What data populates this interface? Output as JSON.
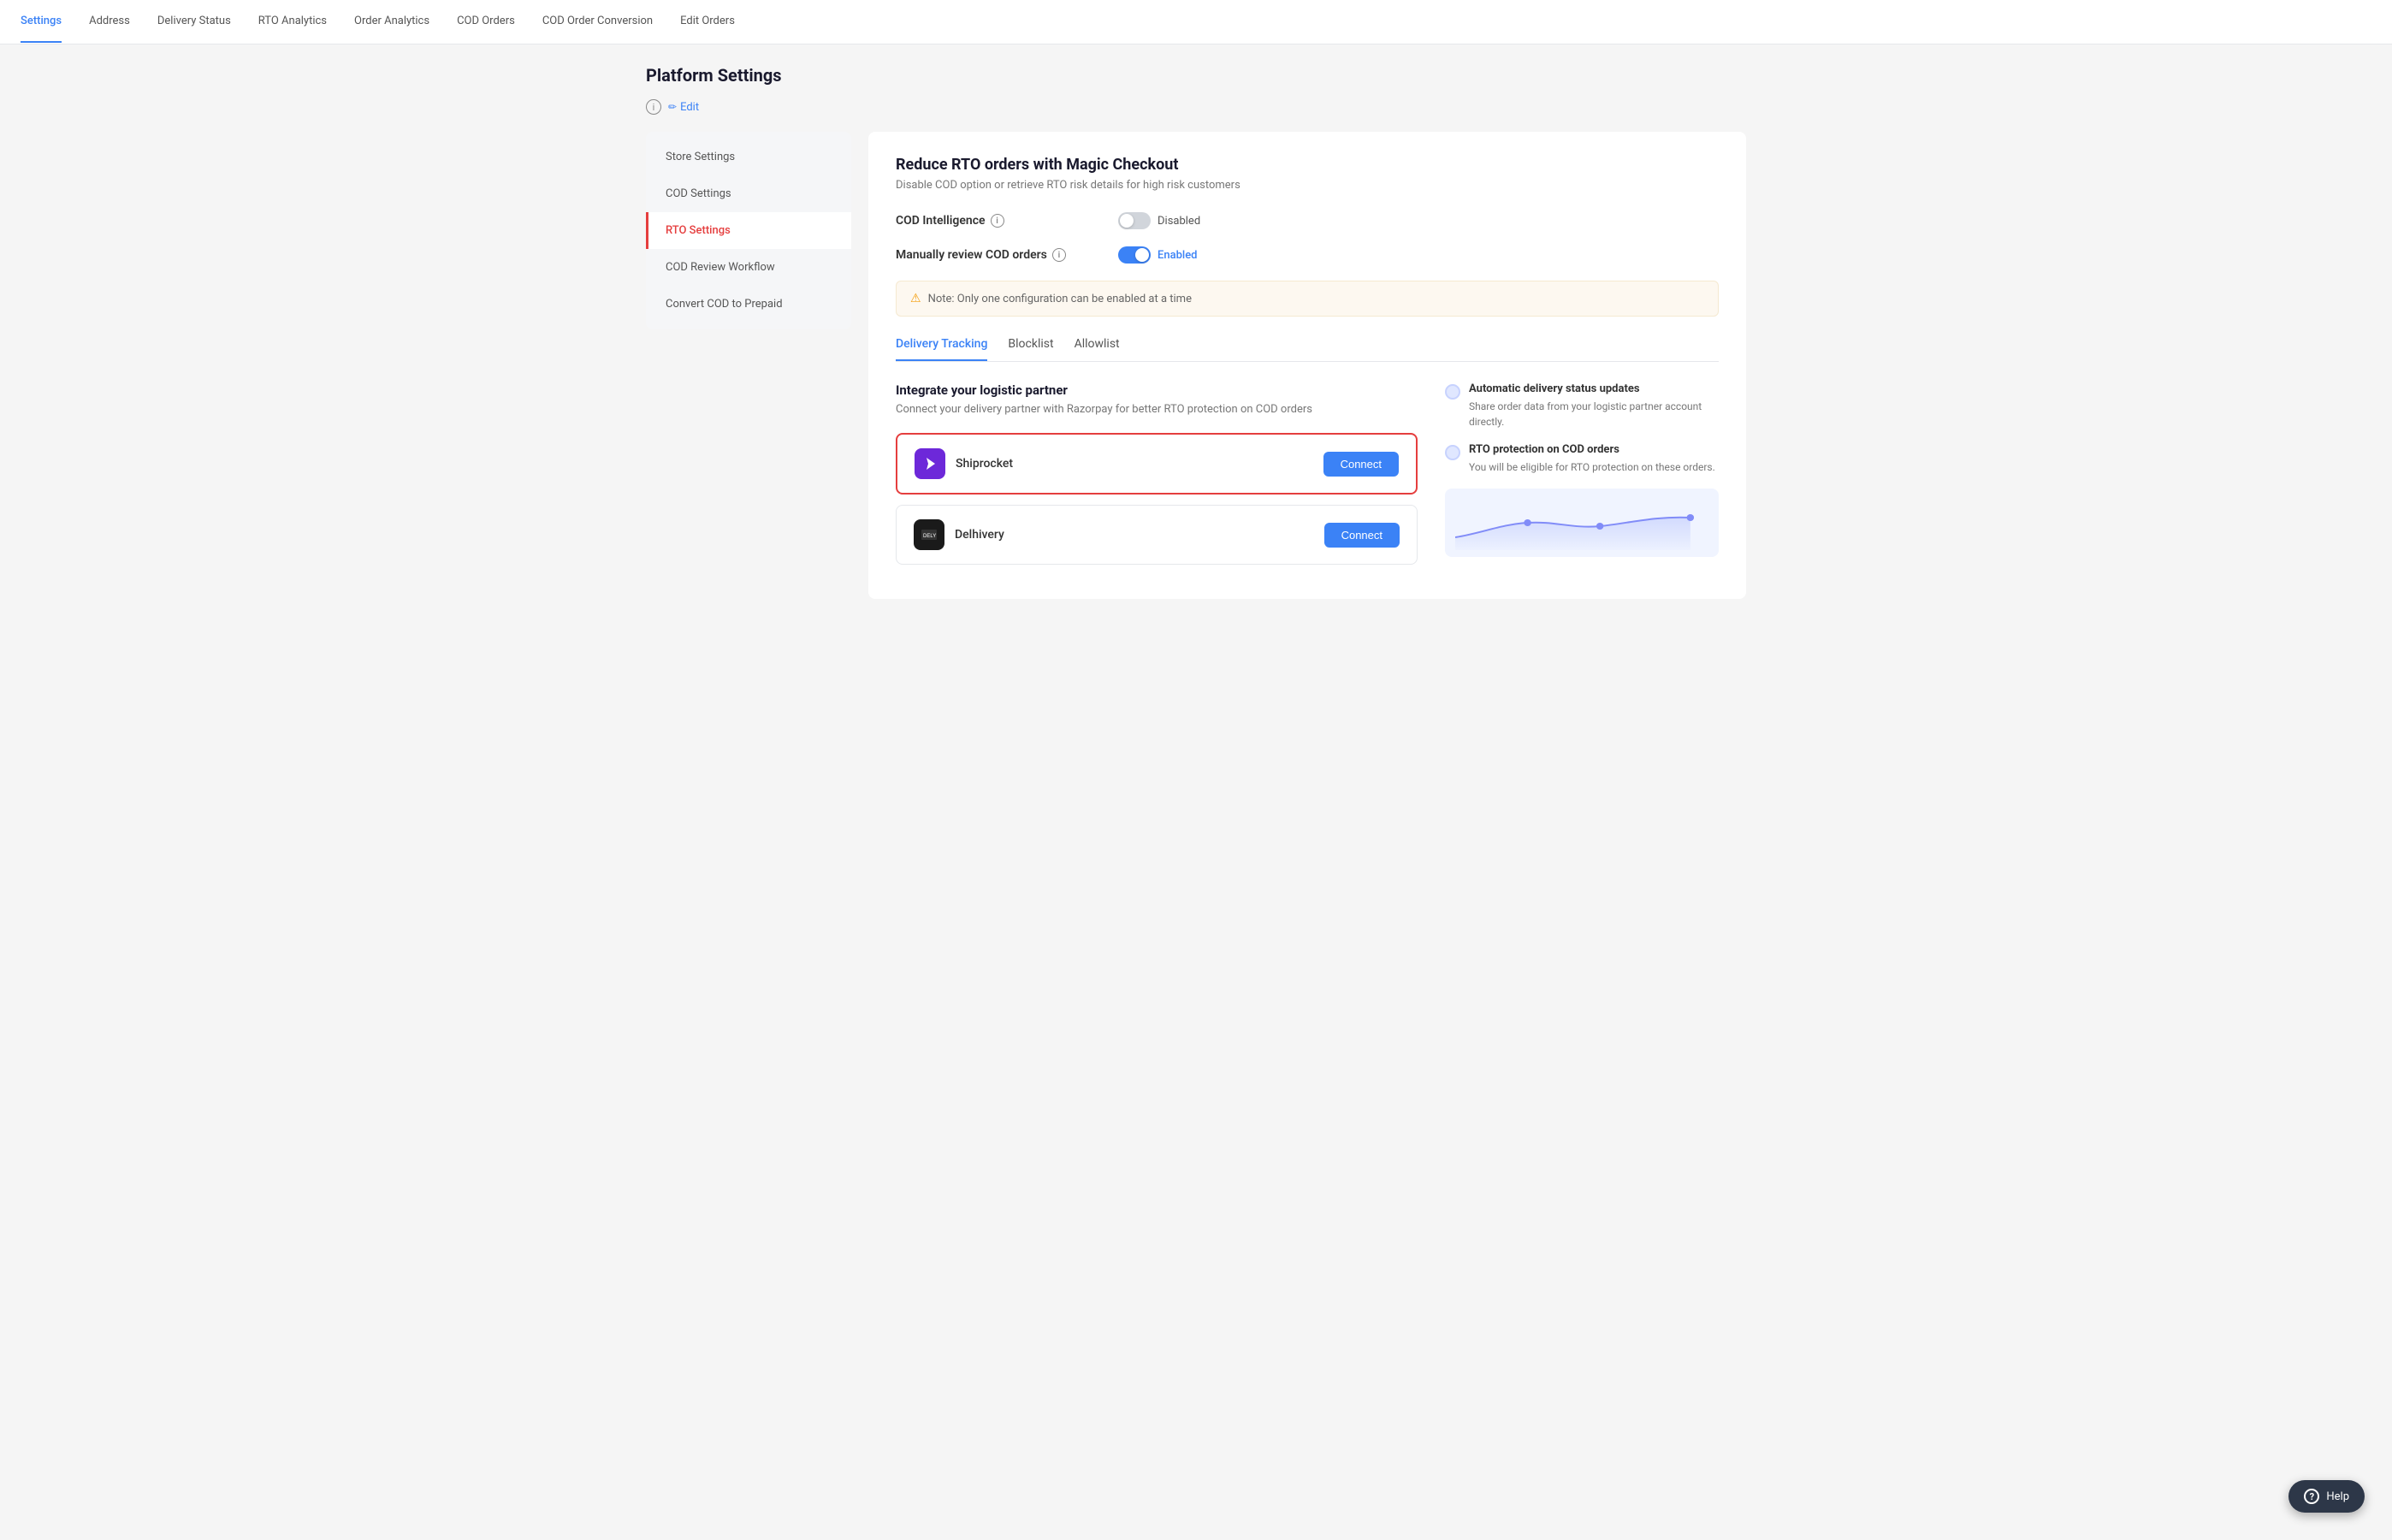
{
  "nav": {
    "items": [
      {
        "label": "Settings",
        "active": true
      },
      {
        "label": "Address",
        "active": false
      },
      {
        "label": "Delivery Status",
        "active": false
      },
      {
        "label": "RTO Analytics",
        "active": false
      },
      {
        "label": "Order Analytics",
        "active": false
      },
      {
        "label": "COD Orders",
        "active": false
      },
      {
        "label": "COD Order Conversion",
        "active": false
      },
      {
        "label": "Edit Orders",
        "active": false
      }
    ]
  },
  "page": {
    "title": "Platform Settings"
  },
  "edit_button": "Edit",
  "sidebar": {
    "items": [
      {
        "label": "Store Settings",
        "active": false
      },
      {
        "label": "COD Settings",
        "active": false
      },
      {
        "label": "RTO Settings",
        "active": true
      },
      {
        "label": "COD Review Workflow",
        "active": false
      },
      {
        "label": "Convert COD to Prepaid",
        "active": false
      }
    ]
  },
  "content": {
    "title": "Reduce RTO orders with Magic Checkout",
    "subtitle": "Disable COD option or retrieve RTO risk details for high risk customers",
    "settings": [
      {
        "label": "COD Intelligence",
        "toggle_state": "off",
        "toggle_text": "Disabled"
      },
      {
        "label": "Manually review COD orders",
        "toggle_state": "on",
        "toggle_text": "Enabled"
      }
    ],
    "note": "Note: Only one configuration can be enabled at a time",
    "tabs": [
      {
        "label": "Delivery Tracking",
        "active": true
      },
      {
        "label": "Blocklist",
        "active": false
      },
      {
        "label": "Allowlist",
        "active": false
      }
    ],
    "integrate": {
      "title": "Integrate your logistic partner",
      "desc": "Connect your delivery partner with Razorpay for better RTO protection on COD orders",
      "partners": [
        {
          "name": "Shiprocket",
          "type": "shiprocket",
          "btn": "Connect",
          "highlighted": true
        },
        {
          "name": "Delhivery",
          "type": "delhivery",
          "btn": "Connect",
          "highlighted": false
        }
      ]
    },
    "benefits": [
      {
        "title": "Automatic delivery status updates",
        "desc": "Share order data from your logistic partner account directly."
      },
      {
        "title": "RTO protection on COD orders",
        "desc": "You will be eligible for RTO protection on these orders."
      }
    ]
  },
  "help": {
    "label": "Help"
  }
}
